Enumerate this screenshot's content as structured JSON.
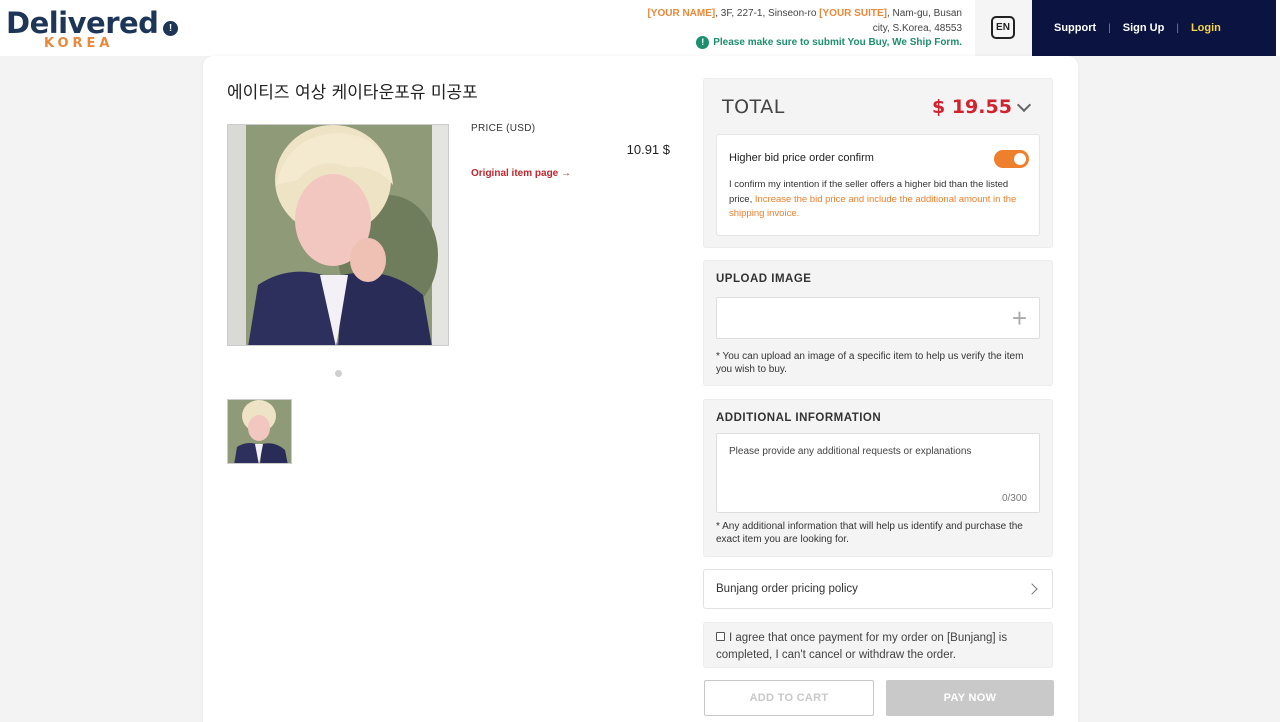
{
  "header": {
    "logo": {
      "word": "Delivered",
      "sub": "KOREA"
    },
    "address": {
      "name_placeholder": "[YOUR NAME]",
      "line1_rest": ", 3F, 227-1, Sinseon-ro ",
      "suite_placeholder": "[YOUR SUITE]",
      "line1_end": ", Nam-gu, Busan",
      "line2": "city, S.Korea, 48553"
    },
    "notice": "Please make sure to submit You Buy, We Ship Form.",
    "language": "EN",
    "nav": {
      "support": "Support",
      "signup": "Sign Up",
      "login": "Login"
    },
    "colors": {
      "nav_bg": "#0b1340",
      "login": "#f6d54a",
      "accent": "#e8883a"
    }
  },
  "product": {
    "title": "에이티즈 여상 케이타운포유 미공포",
    "price_label": "PRICE (USD)",
    "price_value": "10.91 $",
    "original_link": "Original item page"
  },
  "order": {
    "total_label": "TOTAL",
    "total_value": "$ 19.55",
    "bid": {
      "title": "Higher bid price order confirm",
      "toggle_on": true,
      "text_plain": "I confirm my intention if the seller offers a higher bid than the listed price, ",
      "text_highlight": "Increase the bid price and include the additional amount in the shipping invoice."
    },
    "upload": {
      "title": "UPLOAD IMAGE",
      "hint": "* You can upload an image of a specific item to help us verify the item you wish to buy."
    },
    "info": {
      "title": "ADDITIONAL INFORMATION",
      "placeholder": "Please provide any additional requests or explanations",
      "counter": "0/300",
      "hint": "* Any additional information that will help us identify and purchase the exact item you are looking for."
    },
    "policy_label": "Bunjang order pricing policy",
    "agree_text": "I agree that once payment for my order on [Bunjang] is completed, I can't cancel or withdraw the order.",
    "buttons": {
      "add_to_cart": "ADD TO CART",
      "pay_now": "PAY NOW"
    },
    "colors": {
      "total": "#d1222f",
      "toggle": "#ee7f2d"
    }
  }
}
